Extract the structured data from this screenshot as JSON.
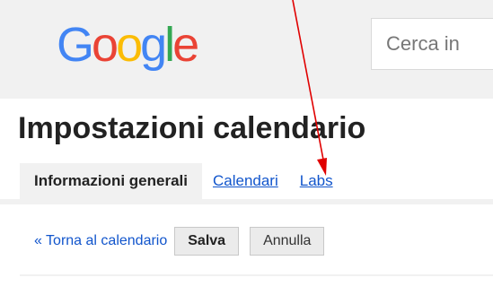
{
  "logo": {
    "letters": [
      "G",
      "o",
      "o",
      "g",
      "l",
      "e"
    ],
    "colors": [
      "#4285f4",
      "#ea4335",
      "#fbbc05",
      "#4285f4",
      "#34a853",
      "#ea4335"
    ]
  },
  "search": {
    "placeholder": "Cerca in"
  },
  "page": {
    "title": "Impostazioni calendario"
  },
  "tabs": [
    {
      "label": "Informazioni generali",
      "active": true
    },
    {
      "label": "Calendari",
      "active": false
    },
    {
      "label": "Labs",
      "active": false
    }
  ],
  "actions": {
    "back_link": "« Torna al calendario",
    "save_label": "Salva",
    "cancel_label": "Annulla"
  },
  "annotation": {
    "color": "#e00000"
  }
}
